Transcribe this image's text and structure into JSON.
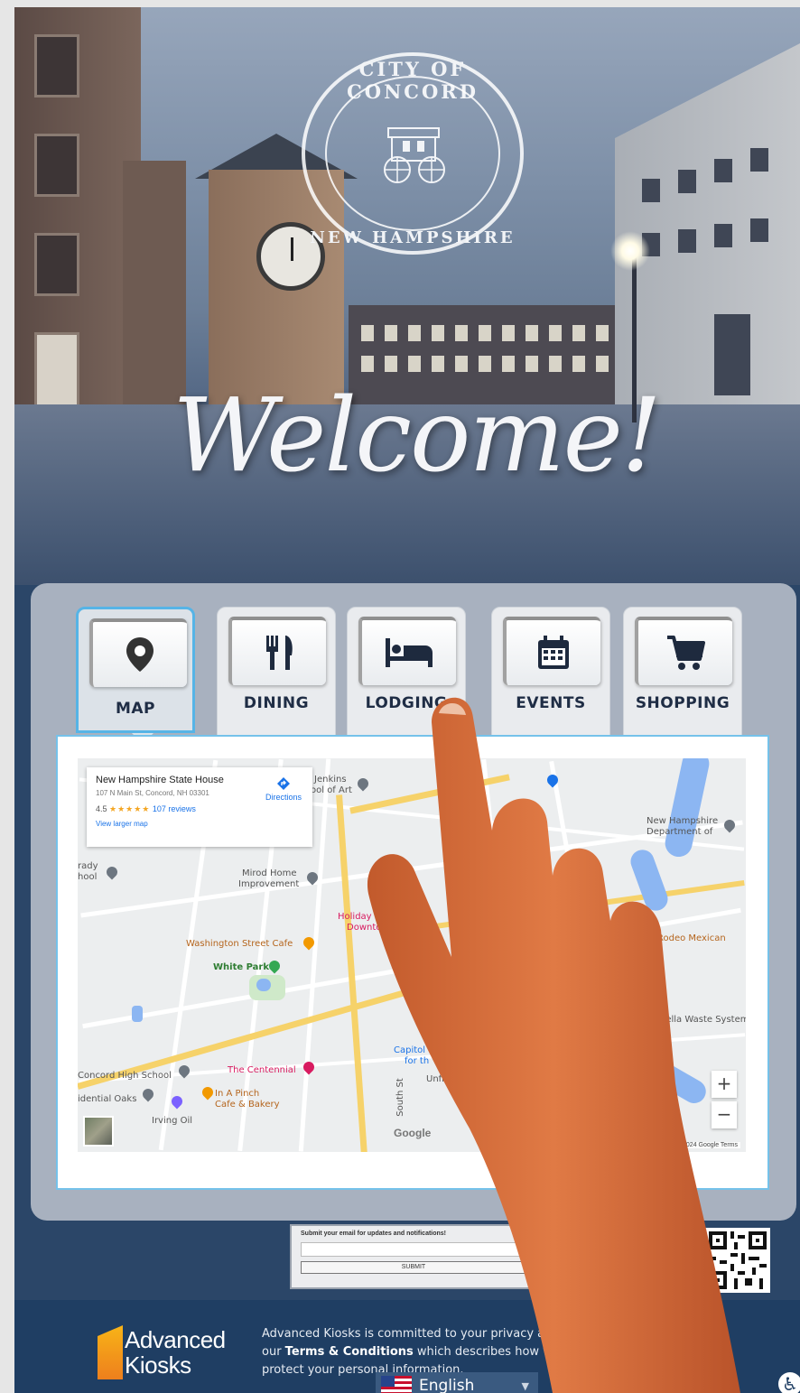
{
  "hero": {
    "seal_top": "CITY OF CONCORD",
    "seal_bottom": "NEW HAMPSHIRE",
    "welcome": "Welcome!"
  },
  "tabs": [
    {
      "label": "MAP",
      "icon": "map-pin-icon",
      "active": true
    },
    {
      "label": "DINING",
      "icon": "fork-knife-icon",
      "active": false
    },
    {
      "label": "LODGING",
      "icon": "bed-icon",
      "active": false
    },
    {
      "label": "EVENTS",
      "icon": "calendar-icon",
      "active": false
    },
    {
      "label": "SHOPPING",
      "icon": "shopping-cart-icon",
      "active": false
    }
  ],
  "map": {
    "place_title": "New Hampshire State House",
    "place_address": "107 N Main St, Concord, NH 03301",
    "rating": "4.5",
    "stars": "★★★★★",
    "reviews": "107 reviews",
    "larger_map": "View larger map",
    "directions": "Directions",
    "labels": [
      "Jenkins",
      "ool of Art",
      "Mirod Home",
      "Improvement",
      "Washington Street Cafe",
      "White Park",
      "Holiday I",
      "Downto",
      "The Centennial",
      "Concord High School",
      "In A Pinch",
      "Cafe & Bakery",
      "idential Oaks",
      "Irving Oil",
      "Capitol",
      "for th",
      "New Hampshire",
      "Department of",
      "Rodeo Mexican",
      "asella Waste Systems",
      "rady",
      "hool",
      "South St",
      "Unfr"
    ],
    "zoom_in": "+",
    "zoom_out": "−",
    "google": "Google",
    "map_data": "Map data ©2024 Google   Terms"
  },
  "email": {
    "prompt": "Submit your email for updates and notifications!",
    "submit": "SUBMIT"
  },
  "footer": {
    "logo_line1": "Advanced",
    "logo_line2": "Kiosks",
    "privacy_1": "Advanced Kiosks is committed to your privacy and",
    "privacy_2a": "our ",
    "privacy_terms": "Terms & Conditions",
    "privacy_2b": " which describes how we",
    "privacy_3": "protect your personal information.",
    "language": "English"
  },
  "colors": {
    "panel": "#a8b1bf",
    "active_tab_border": "#56b4e6",
    "footer": "#1f3e63",
    "logo_orange": "#f39a1b"
  }
}
